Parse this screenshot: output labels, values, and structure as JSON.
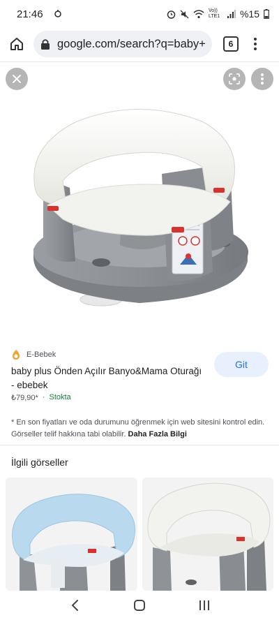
{
  "status": {
    "time": "21:46",
    "battery": "%15",
    "network": "Vo)) LTE1"
  },
  "browser": {
    "url": "google.com/search?q=baby+",
    "tab_count": "6"
  },
  "result": {
    "source_name": "E-Bebek",
    "title": "baby plus Önden Açılır Banyo&Mama Oturağı - ebebek",
    "price": "₺79,90*",
    "separator": "·",
    "availability": "Stokta",
    "visit_button": "Git"
  },
  "disclaimer": {
    "text": "* En son fiyatları ve oda durumunu öğrenmek için web sitesini kontrol edin. Görseller telif hakkına tabi olabilir.",
    "more_link": "Daha Fazla Bilgi"
  },
  "related": {
    "title": "İlgili görseller"
  },
  "colors": {
    "accent": "#1a73e8",
    "stock_green": "#188038",
    "button_bg": "#e8f0fe",
    "seat_grey": "#8e9196",
    "seat_white": "#f2f2ee",
    "seat_blue": "#b9d9ef"
  },
  "icons": {
    "home": "home-icon",
    "lock": "lock-icon",
    "close": "close-icon",
    "lens": "lens-icon",
    "more": "more-vert-icon",
    "source_logo": "ebebek-logo-icon",
    "nav_back": "back-icon",
    "nav_home": "nav-home-icon",
    "nav_recents": "recents-icon"
  }
}
